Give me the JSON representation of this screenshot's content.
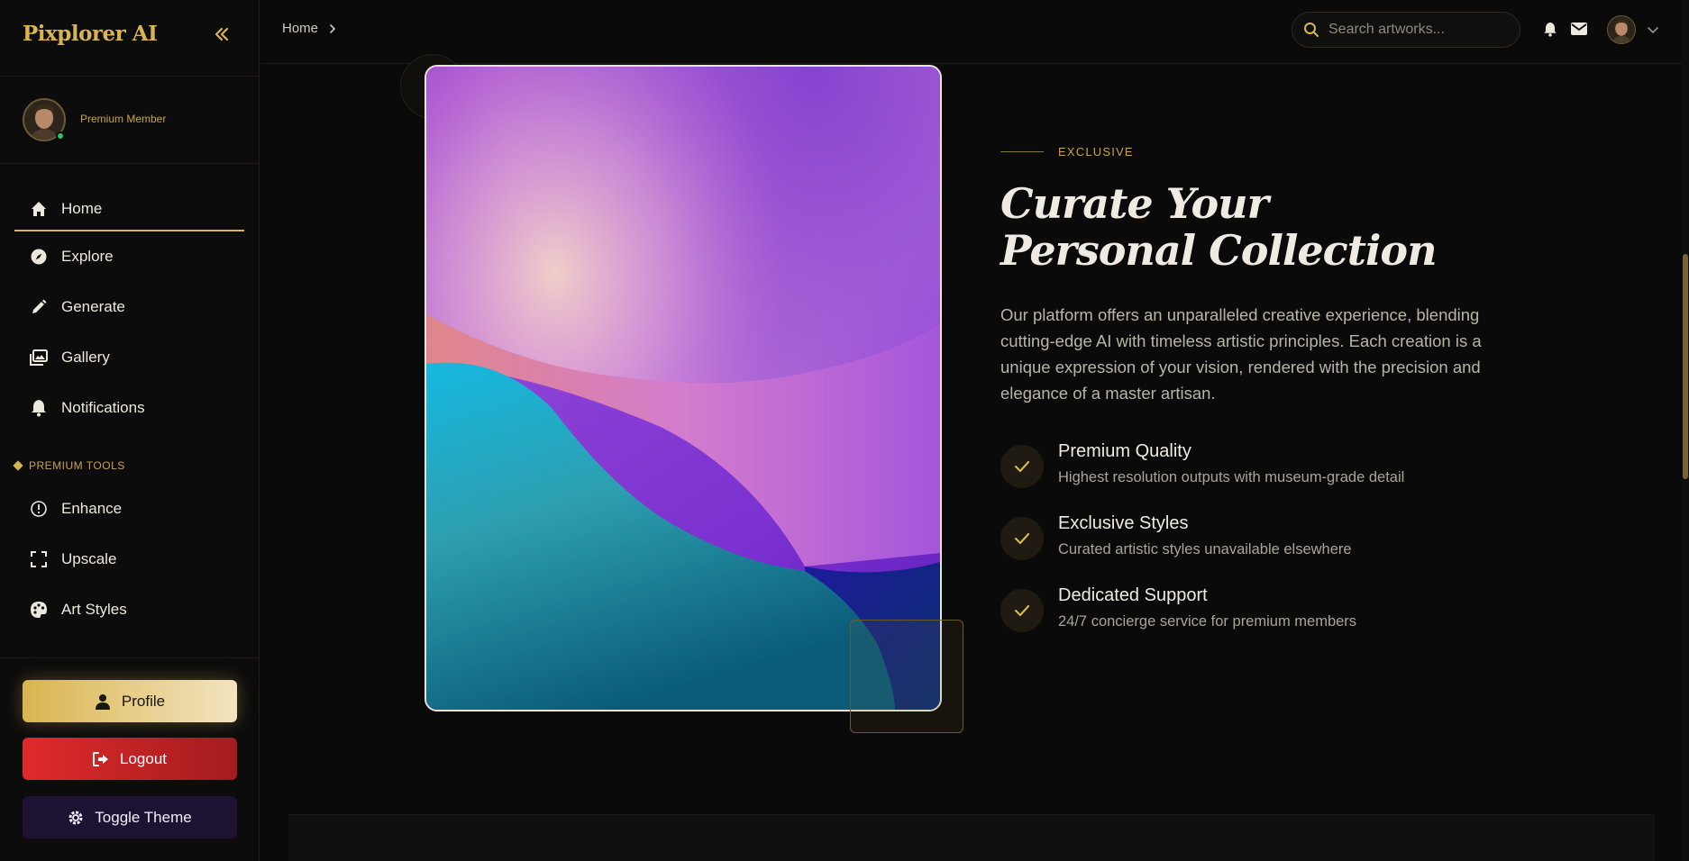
{
  "app": {
    "brand": "Pixplorer AI"
  },
  "user": {
    "membership": "Premium Member"
  },
  "sidebar": {
    "nav": [
      {
        "label": "Home",
        "icon": "home-icon"
      },
      {
        "label": "Explore",
        "icon": "compass-icon"
      },
      {
        "label": "Generate",
        "icon": "pencil-icon"
      },
      {
        "label": "Gallery",
        "icon": "images-icon"
      },
      {
        "label": "Notifications",
        "icon": "bell-icon"
      }
    ],
    "section_label": "PREMIUM TOOLS",
    "tools": [
      {
        "label": "Enhance",
        "icon": "info-icon"
      },
      {
        "label": "Upscale",
        "icon": "expand-icon"
      },
      {
        "label": "Art Styles",
        "icon": "palette-icon"
      }
    ],
    "buttons": {
      "profile": "Profile",
      "logout": "Logout",
      "toggle_theme": "Toggle Theme"
    }
  },
  "topbar": {
    "breadcrumb": "Home",
    "search_placeholder": "Search artworks..."
  },
  "hero": {
    "eyebrow": "EXCLUSIVE",
    "title_line1": "Curate Your",
    "title_line2": "Personal Collection",
    "description": "Our platform offers an unparalleled creative experience, blending cutting-edge AI with timeless artistic principles. Each creation is a unique expression of your vision, rendered with the precision and elegance of a master artisan.",
    "features": [
      {
        "title": "Premium Quality",
        "desc": "Highest resolution outputs with museum-grade detail"
      },
      {
        "title": "Exclusive Styles",
        "desc": "Curated artistic styles unavailable elsewhere"
      },
      {
        "title": "Dedicated Support",
        "desc": "24/7 concierge service for premium members"
      }
    ]
  },
  "colors": {
    "accent_gold": "#d9b552",
    "background": "#0a0a0a",
    "logout_red": "#e02a2a",
    "theme_purple": "#1e1233",
    "online_green": "#28c36a"
  }
}
